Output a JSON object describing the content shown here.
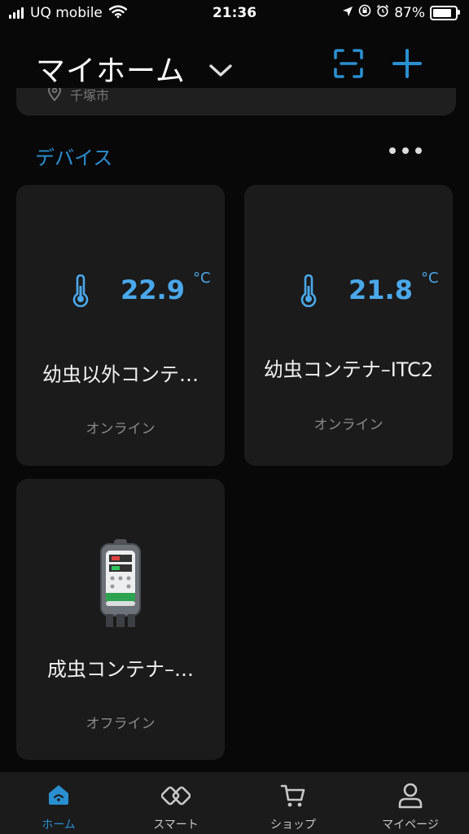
{
  "status_bar": {
    "carrier": "UQ mobile",
    "time": "21:36",
    "battery": "87%",
    "battery_level": 0.87
  },
  "header": {
    "title": "マイホーム",
    "location": "千塚市"
  },
  "devices_section": {
    "title": "デバイス"
  },
  "devices": [
    {
      "name": "幼虫以外コンテ…",
      "temperature": "22.9",
      "unit": "°C",
      "status": "オンライン"
    },
    {
      "name": "幼虫コンテナ–ITC2",
      "temperature": "21.8",
      "unit": "°C",
      "status": "オンライン"
    },
    {
      "name": "成虫コンテナ–…",
      "status": "オフライン"
    }
  ],
  "tabs": [
    {
      "label": "ホーム",
      "icon": "home-icon",
      "active": true
    },
    {
      "label": "スマート",
      "icon": "smart-link-icon",
      "active": false
    },
    {
      "label": "ショップ",
      "icon": "cart-icon",
      "active": false
    },
    {
      "label": "マイページ",
      "icon": "person-icon",
      "active": false
    }
  ],
  "colors": {
    "accent": "#2a8fd0",
    "temperature": "#4aa8ea",
    "background": "#080808",
    "card": "#1b1b1b"
  }
}
